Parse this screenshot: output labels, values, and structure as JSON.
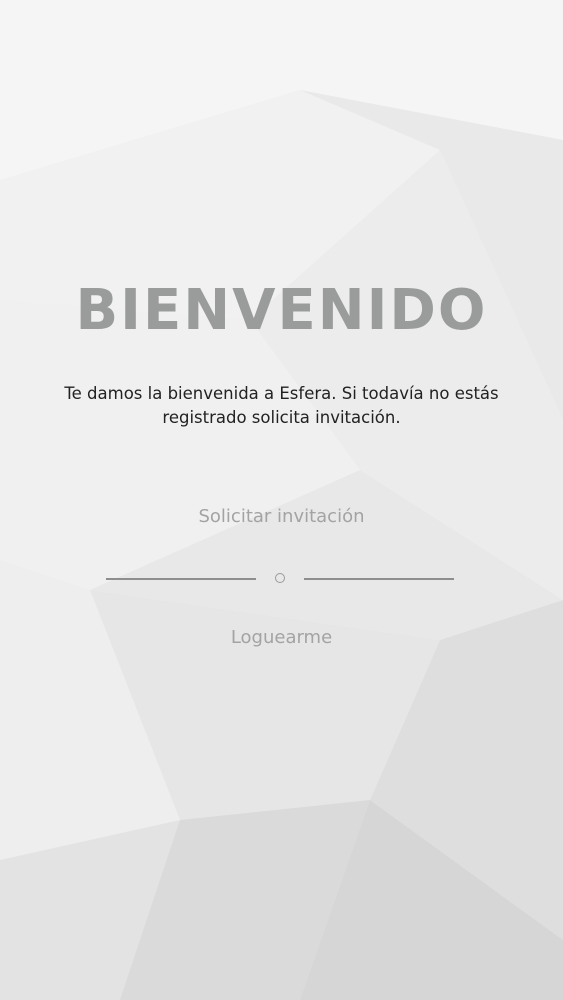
{
  "welcome": {
    "title": "BIENVENIDO",
    "message_line1": "Te damos la bienvenida a Esfera. Si todavía no estás",
    "message_line2": "registrado solicita invitación."
  },
  "actions": {
    "request_invitation_label": "Solicitar invitación",
    "login_label": "Loguearme"
  },
  "colors": {
    "title": "#9a9c9c",
    "link": "#a3a3a3",
    "divider": "#8e8e8e",
    "background": "#efefef"
  }
}
